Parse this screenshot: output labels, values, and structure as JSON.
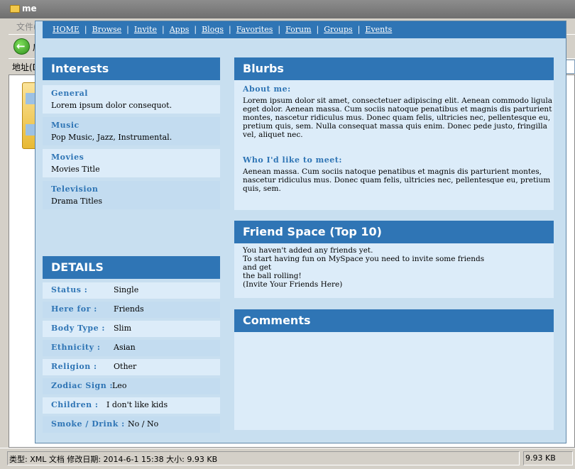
{
  "window": {
    "title": "me",
    "menu_text": "文件(",
    "back_label": "后",
    "address_label": "地址(D",
    "status_text": "类型: XML 文档 修改日期: 2014-6-1 15:38 大小: 9.93 KB",
    "status_size": "9.93 KB"
  },
  "nav": {
    "links": [
      "HOME",
      "Browse",
      "Invite",
      "Apps",
      "Blogs",
      "Favorites",
      "Forum",
      "Groups",
      "Events"
    ],
    "separator": "|"
  },
  "interests": {
    "title": "Interests",
    "items": [
      {
        "label": "General",
        "value": "Lorem ipsum dolor consequot."
      },
      {
        "label": "Music",
        "value": "Pop Music, Jazz, Instrumental."
      },
      {
        "label": "Movies",
        "value": "Movies Title"
      },
      {
        "label": "Television",
        "value": "Drama Titles"
      }
    ]
  },
  "details": {
    "title": "DETAILS",
    "items": [
      {
        "label": "Status :",
        "value": "Single"
      },
      {
        "label": "Here for :",
        "value": "Friends"
      },
      {
        "label": "Body Type :",
        "value": "Slim"
      },
      {
        "label": "Ethnicity :",
        "value": "Asian"
      },
      {
        "label": "Religion :",
        "value": "Other"
      },
      {
        "label": "Zodiac Sign :",
        "value": "Leo"
      },
      {
        "label": "Children :",
        "value": "I don't like kids"
      },
      {
        "label": "Smoke / Drink :",
        "value": "No / No"
      }
    ]
  },
  "blurbs": {
    "title": "Blurbs",
    "about_label": "About me:",
    "about_text": "Lorem ipsum dolor sit amet, consectetuer adipiscing elit. Aenean commodo ligula eget dolor. Aenean massa. Cum sociis natoque penatibus et magnis dis parturient montes, nascetur ridiculus mus. Donec quam felis, ultricies nec, pellentesque eu, pretium quis, sem. Nulla consequat massa quis enim. Donec pede justo, fringilla vel, aliquet nec.",
    "meet_label": "Who I'd like to meet:",
    "meet_text": "Aenean massa. Cum sociis natoque penatibus et magnis dis parturient montes, nascetur ridiculus mus. Donec quam felis, ultricies nec, pellentesque eu, pretium quis, sem."
  },
  "friends": {
    "title": "Friend Space (Top 10)",
    "lines": [
      "You haven't added any friends yet.",
      "To start having fun on MySpace you need to invite some friends",
      "and get",
      "the ball rolling!",
      "(Invite Your Friends Here)"
    ]
  },
  "comments": {
    "title": "Comments"
  },
  "colors": {
    "header_blue": "#2f75b5",
    "panel_light": "#dcecf9",
    "row_alt": "#c3dcf0",
    "page_bg": "#c8dff0"
  }
}
